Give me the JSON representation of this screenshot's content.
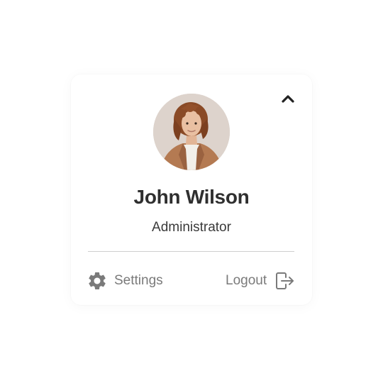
{
  "profile": {
    "name": "John Wilson",
    "role": "Administrator"
  },
  "icons": {
    "collapse": "chevron-up-icon",
    "settings": "gear-icon",
    "logout": "logout-icon"
  },
  "actions": {
    "settings_label": "Settings",
    "logout_label": "Logout"
  },
  "colors": {
    "name_text": "#2f2f2f",
    "muted_text": "#7a7a7a",
    "divider": "#cfcfcf",
    "chevron": "#222222"
  }
}
